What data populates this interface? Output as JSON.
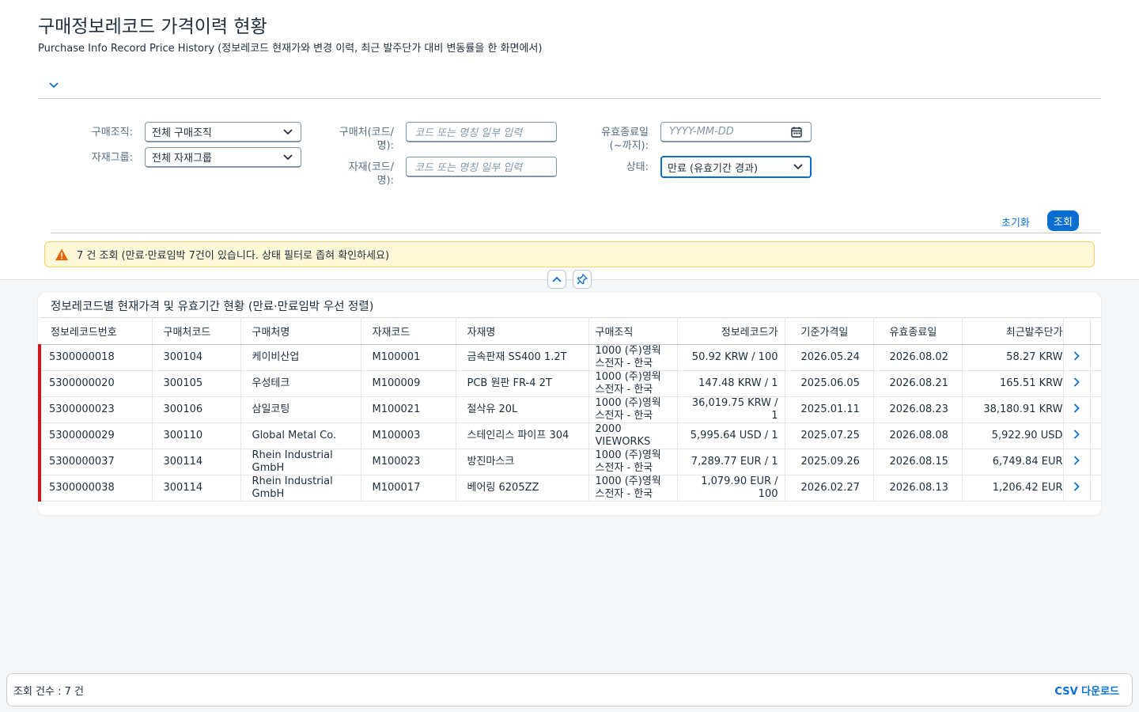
{
  "header": {
    "title": "구매정보레코드 가격이력 현황",
    "subtitle": "Purchase Info Record Price History (정보레코드 현재가와 변경 이력, 최근 발주단가 대비 변동률을 한 화면에서)"
  },
  "filters": {
    "purch_org_label": "구매조직:",
    "purch_org_value": "전체 구매조직",
    "mat_group_label": "자재그룹:",
    "mat_group_value": "전체 자재그룹",
    "vendor_label_1": "구매처(코드/",
    "vendor_label_2": "명):",
    "vendor_placeholder": "코드 또는 명칭 일부 입력",
    "material_label_1": "자재(코드/",
    "material_label_2": "명):",
    "material_placeholder": "코드 또는 명칭 일부 입력",
    "valid_to_label_1": "유효종료일",
    "valid_to_label_2": "(~까지):",
    "valid_to_placeholder": "YYYY-MM-DD",
    "status_label": "상태:",
    "status_value": "만료 (유효기간 경과)"
  },
  "actions": {
    "reset": "초기화",
    "search": "조회"
  },
  "message": "7 건 조회 (만료·만료임박 7건이 있습니다. 상태 필터로 좁혀 확인하세요)",
  "table": {
    "title": "정보레코드별 현재가격 및 유효기간 현황 (만료·만료임박 우선 정렬)",
    "columns": [
      "정보레코드번호",
      "구매처코드",
      "구매처명",
      "자재코드",
      "자재명",
      "구매조직",
      "정보레코드가",
      "기준가격일",
      "유효종료일",
      "최근발주단가"
    ],
    "rows": [
      {
        "id": "5300000018",
        "vendor": "300104",
        "vendor_name": "케이비산업",
        "mat": "M100001",
        "mat_name": "금속판재 SS400 1.2T",
        "org1": "1000 (주)영웍",
        "org2": "스전자 - 한국",
        "price": "50.92 KRW / 100",
        "price_date": "2026.05.24",
        "valid_to": "2026.08.02",
        "last_po": "58.27 KRW"
      },
      {
        "id": "5300000020",
        "vendor": "300105",
        "vendor_name": "우성테크",
        "mat": "M100009",
        "mat_name": "PCB 원판 FR-4 2T",
        "org1": "1000 (주)영웍",
        "org2": "스전자 - 한국",
        "price": "147.48 KRW / 1",
        "price_date": "2025.06.05",
        "valid_to": "2026.08.21",
        "last_po": "165.51 KRW"
      },
      {
        "id": "5300000023",
        "vendor": "300106",
        "vendor_name": "삼일코팅",
        "mat": "M100021",
        "mat_name": "절삭유 20L",
        "org1": "1000 (주)영웍",
        "org2": "스전자 - 한국",
        "price": "36,019.75 KRW / 1",
        "price_date": "2025.01.11",
        "valid_to": "2026.08.23",
        "last_po": "38,180.91 KRW"
      },
      {
        "id": "5300000029",
        "vendor": "300110",
        "vendor_name": "Global Metal Co.",
        "mat": "M100003",
        "mat_name": "스테인리스 파이프 304",
        "org1": "2000",
        "org2": "VIEWORKS",
        "price": "5,995.64 USD / 1",
        "price_date": "2025.07.25",
        "valid_to": "2026.08.08",
        "last_po": "5,922.90 USD"
      },
      {
        "id": "5300000037",
        "vendor": "300114",
        "vendor_name": "Rhein Industrial GmbH",
        "mat": "M100023",
        "mat_name": "방진마스크",
        "org1": "1000 (주)영웍",
        "org2": "스전자 - 한국",
        "price": "7,289.77 EUR / 1",
        "price_date": "2025.09.26",
        "valid_to": "2026.08.15",
        "last_po": "6,749.84 EUR"
      },
      {
        "id": "5300000038",
        "vendor": "300114",
        "vendor_name": "Rhein Industrial GmbH",
        "mat": "M100017",
        "mat_name": "베어링 6205ZZ",
        "org1": "1000 (주)영웍",
        "org2": "스전자 - 한국",
        "price": "1,079.90 EUR / 100",
        "price_date": "2026.02.27",
        "valid_to": "2026.08.13",
        "last_po": "1,206.42 EUR"
      }
    ]
  },
  "footer": {
    "count": "조회 건수 : 7 건",
    "csv": "CSV 다운로드"
  },
  "colors": {
    "accent": "#0a6ed1",
    "error_bar": "#cc1919",
    "warning_bg": "#fef7d8"
  }
}
